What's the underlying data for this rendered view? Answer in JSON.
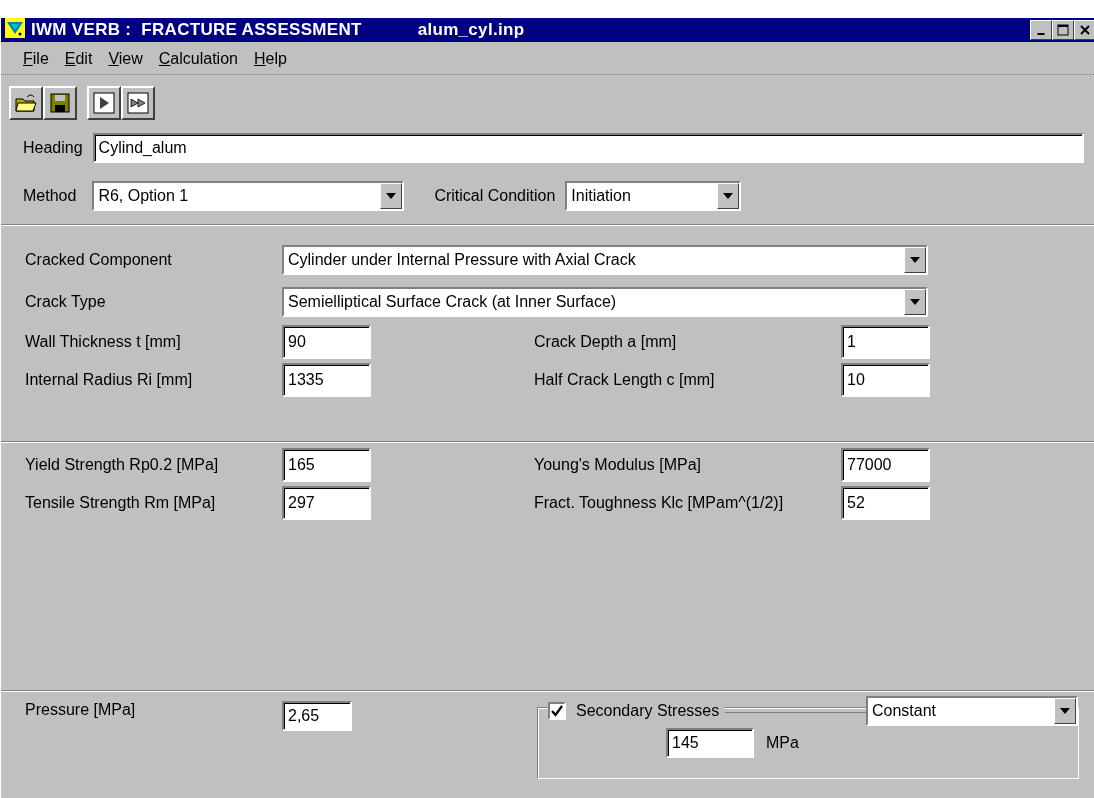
{
  "window": {
    "title": "IWM VERB :  FRACTURE ASSESSMENT",
    "file": "alum_cyl.inp"
  },
  "menu": [
    "File",
    "Edit",
    "View",
    "Calculation",
    "Help"
  ],
  "heading": {
    "label": "Heading",
    "value": "Cylind_alum"
  },
  "method": {
    "label": "Method",
    "value": "R6, Option 1"
  },
  "critical_condition": {
    "label": "Critical Condition",
    "value": "Initiation"
  },
  "cracked_component": {
    "label": "Cracked Component",
    "value": "Cylinder under Internal Pressure with Axial Crack"
  },
  "crack_type": {
    "label": "Crack Type",
    "value": "Semielliptical Surface Crack (at Inner Surface)"
  },
  "geometry": [
    {
      "label": "Wall Thickness t [mm]",
      "value": "90"
    },
    {
      "label": "Crack Depth a [mm]",
      "value": "1"
    },
    {
      "label": "Internal Radius Ri [mm]",
      "value": "1335"
    },
    {
      "label": "Half Crack Length c [mm]",
      "value": "10"
    }
  ],
  "material": [
    {
      "label": "Yield Strength Rp0.2 [MPa]",
      "value": "165"
    },
    {
      "label": "Young's Modulus [MPa]",
      "value": "77000"
    },
    {
      "label": "Tensile Strength Rm [MPa]",
      "value": "297"
    },
    {
      "label": "Fract. Toughness Klc [MPam^(1/2)]",
      "value": "52"
    }
  ],
  "pressure": {
    "label": "Pressure [MPa]",
    "value": "2,65"
  },
  "secondary_stresses": {
    "label": "Secondary Stresses",
    "checked": true,
    "mode": "Constant",
    "value": "145",
    "unit": "MPa"
  }
}
